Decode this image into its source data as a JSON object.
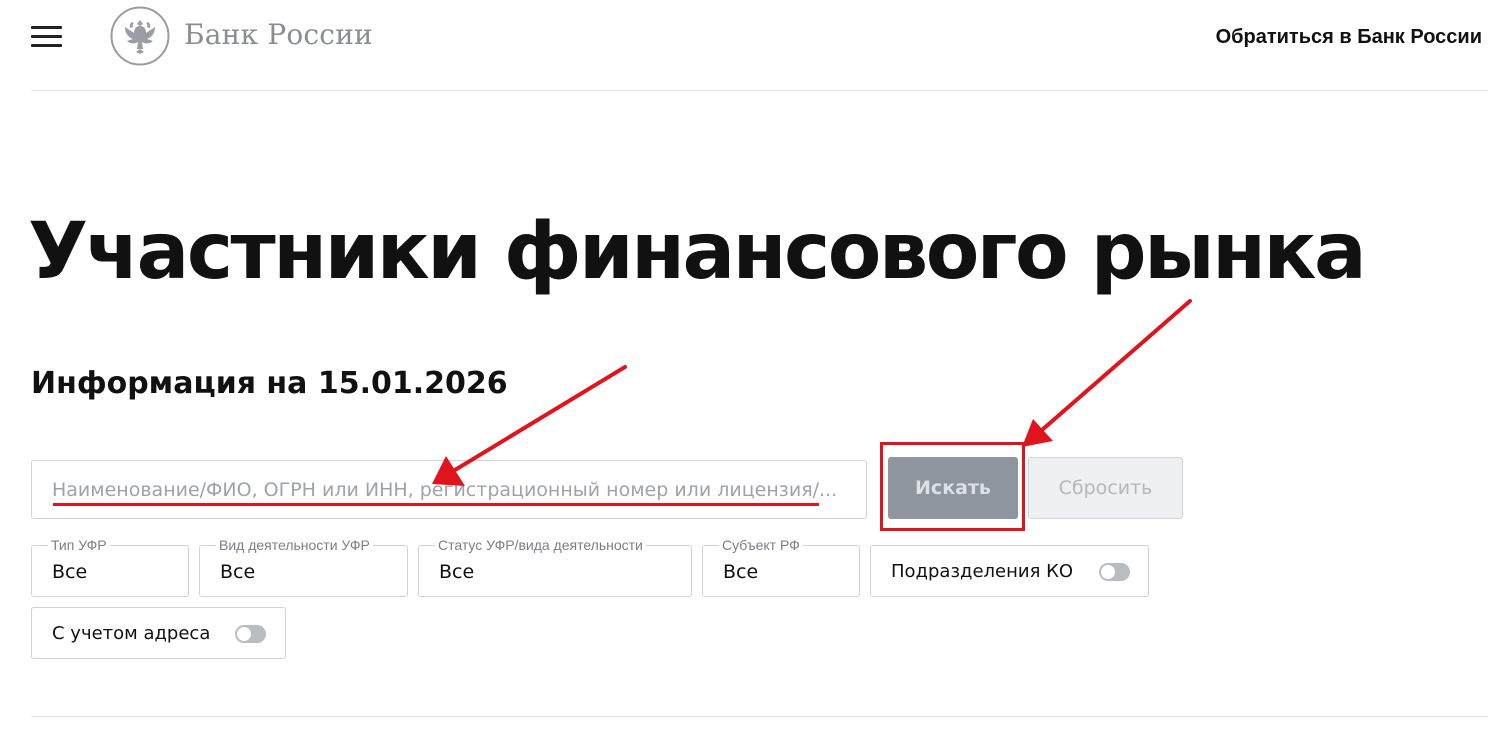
{
  "header": {
    "menu_icon": "hamburger-menu-icon",
    "logo_icon": "double-headed-eagle-emblem",
    "logo_text": "Банк России",
    "contact_link": "Обратиться в Банк России"
  },
  "main": {
    "title": "Участники финансового рынка",
    "info_date": "Информация на 15.01.2026"
  },
  "search": {
    "placeholder": "Наименование/ФИО, ОГРН или ИНН, регистрационный номер или лицензия/...",
    "value": "",
    "search_button": "Искать",
    "reset_button": "Сбросить"
  },
  "filters": [
    {
      "label": "Тип УФР",
      "value": "Все"
    },
    {
      "label": "Вид деятельности УФР",
      "value": "Все"
    },
    {
      "label": "Статус УФР/вида деятельности",
      "value": "Все"
    },
    {
      "label": "Субъект РФ",
      "value": "Все"
    }
  ],
  "toggles": [
    {
      "label": "Подразделения КО",
      "on": false
    },
    {
      "label": "С учетом адреса",
      "on": false
    }
  ],
  "colors": {
    "annotation": "#e0141c",
    "search_button_bg": "#8e959e",
    "reset_button_bg": "#eef0f2",
    "border": "#cfd2d6"
  }
}
